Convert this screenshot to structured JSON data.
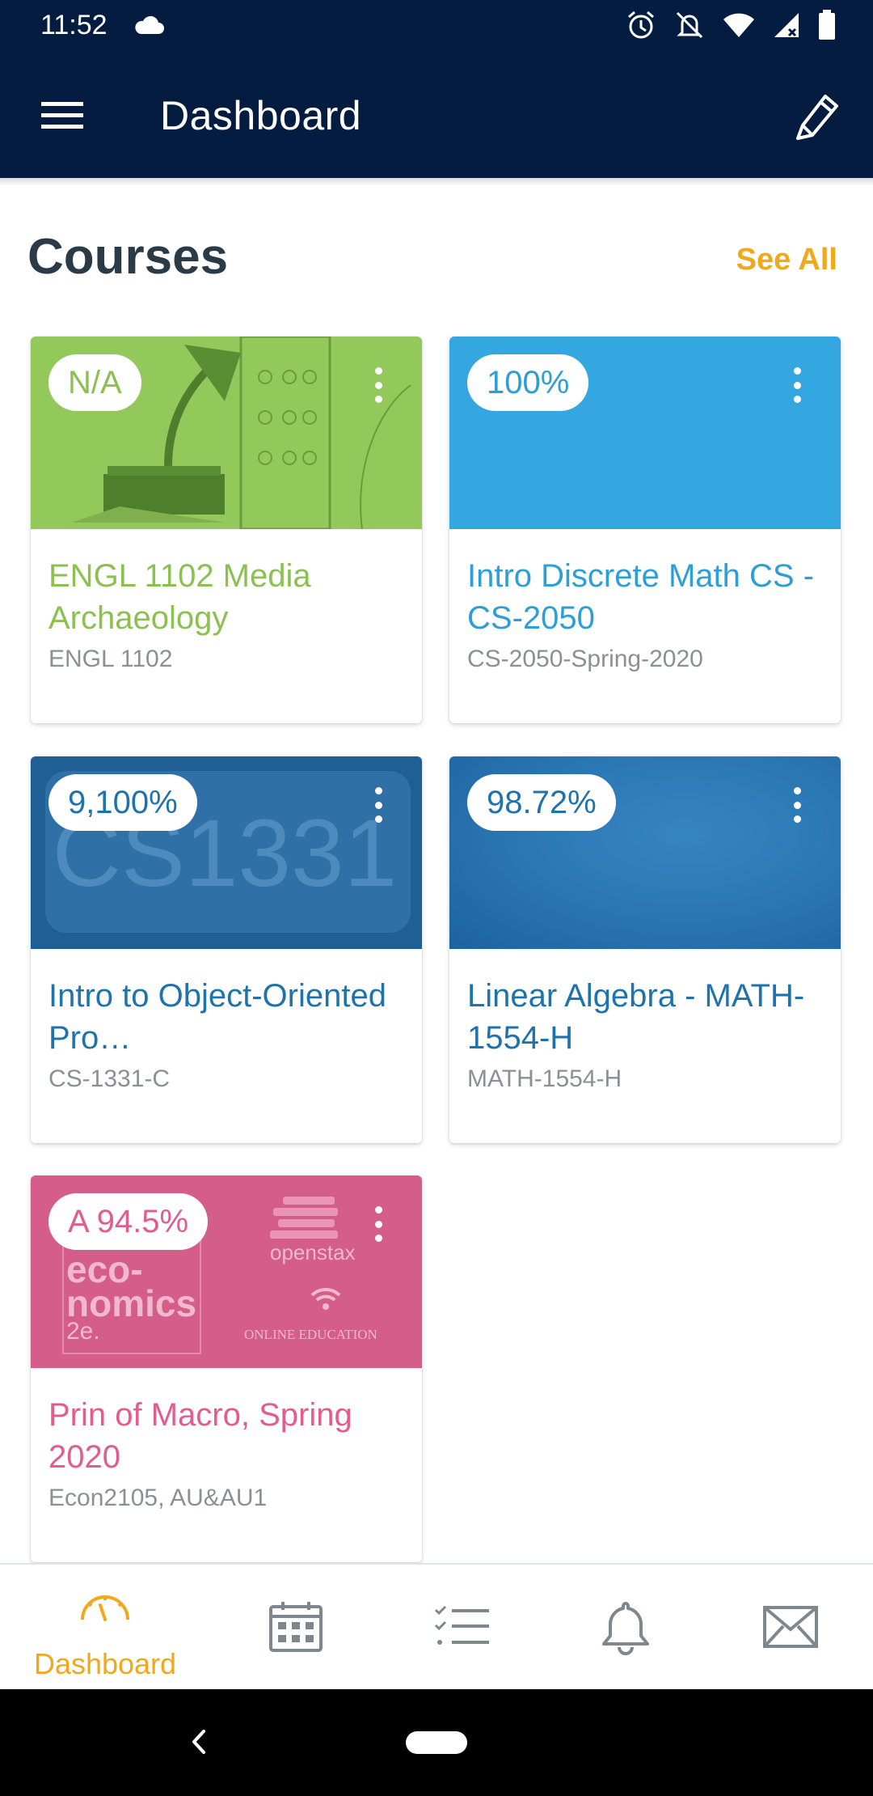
{
  "status_bar": {
    "time": "11:52"
  },
  "app_bar": {
    "title": "Dashboard",
    "menu_icon": "hamburger-icon",
    "edit_icon": "pencil-icon"
  },
  "section": {
    "title": "Courses",
    "see_all": "See All"
  },
  "courses": [
    {
      "grade": "N/A",
      "title": "ENGL 1102 Media Archaeology",
      "code": "ENGL 1102",
      "color": "#8cc152",
      "image_color": "#93c95a"
    },
    {
      "grade": "100%",
      "title": "Intro Discrete Math CS - CS-2050",
      "code": "CS-2050-Spring-2020",
      "color": "#2e9fd6",
      "image_color": "#34a6e0"
    },
    {
      "grade": "9,100%",
      "title": "Intro to Object-Oriented Pro…",
      "code": "CS-1331-C",
      "color": "#1f73ad",
      "image_color": "#1f5f96",
      "image_text": "CS1331"
    },
    {
      "grade": "98.72%",
      "title": "Linear Algebra - MATH-1554-H",
      "code": "MATH-1554-H",
      "color": "#1f73ad",
      "image_color": "#2a77b3"
    },
    {
      "grade": "A 94.5%",
      "title": "Prin of Macro, Spring 2020",
      "code": "Econ2105, AU&AU1",
      "color": "#e35d8c",
      "image_color": "#d45d89",
      "image_text_lines": [
        "eco-",
        "nomics",
        "2e."
      ],
      "image_brand": "openstax",
      "image_footer": "ONLINE EDUCATION"
    }
  ],
  "bottom_nav": [
    {
      "label": "Dashboard",
      "icon": "speedometer-icon",
      "active": true
    },
    {
      "label": "",
      "icon": "calendar-icon",
      "active": false
    },
    {
      "label": "",
      "icon": "todo-list-icon",
      "active": false
    },
    {
      "label": "",
      "icon": "bell-icon",
      "active": false
    },
    {
      "label": "",
      "icon": "mail-icon",
      "active": false
    }
  ],
  "colors": {
    "app_bar": "#041c3f",
    "accent": "#f0a81c"
  }
}
